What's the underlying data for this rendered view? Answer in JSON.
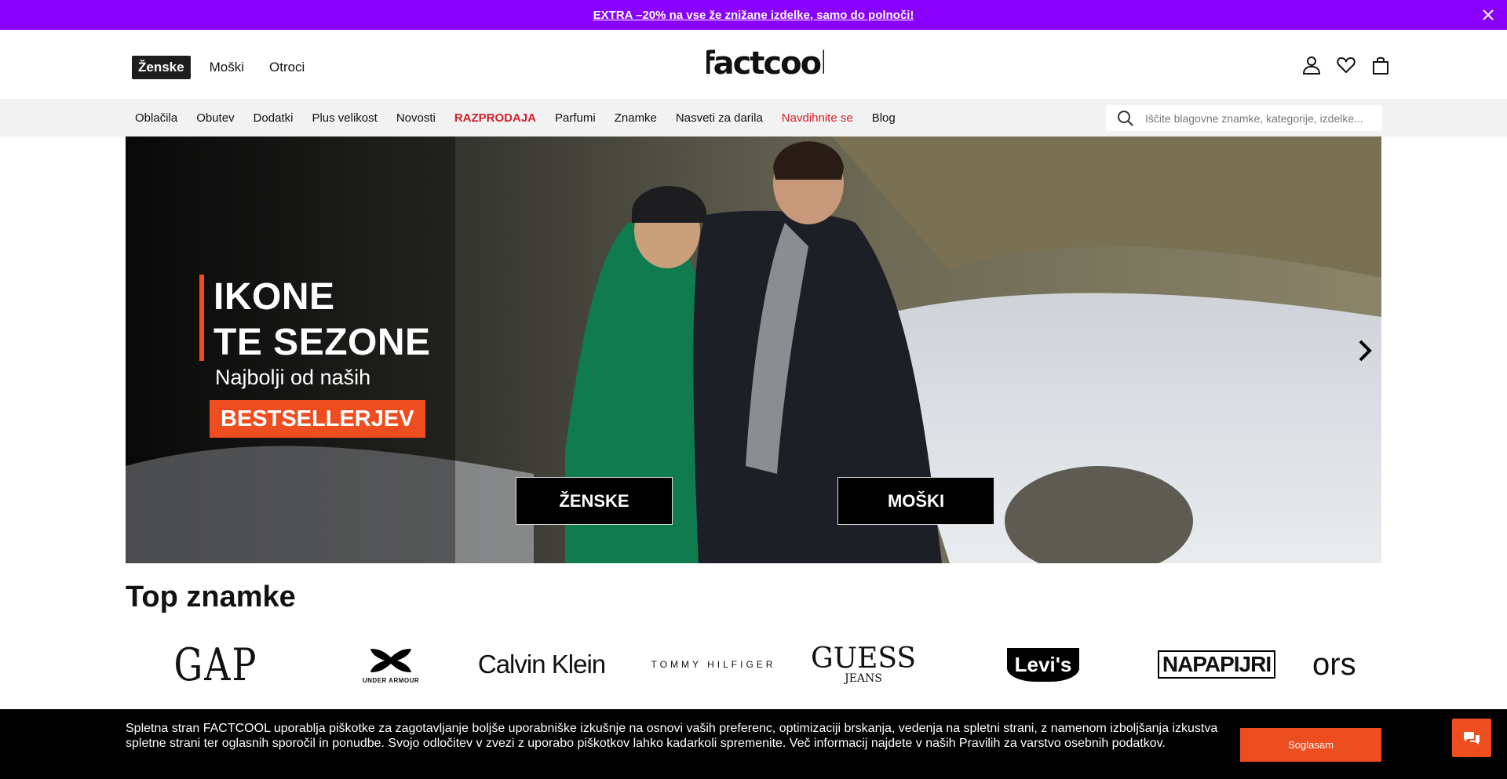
{
  "promo": {
    "text": "EXTRA –20% na vse že znižane izdelke, samo do polnoči!",
    "close_icon": "close-icon"
  },
  "header": {
    "genders": [
      {
        "label": "Ženske",
        "active": true
      },
      {
        "label": "Moški",
        "active": false
      },
      {
        "label": "Otroci",
        "active": false
      }
    ],
    "logo": "factcool",
    "icons": [
      "user-icon",
      "heart-icon",
      "bag-icon"
    ]
  },
  "nav": {
    "categories": [
      {
        "label": "Oblačila"
      },
      {
        "label": "Obutev"
      },
      {
        "label": "Dodatki"
      },
      {
        "label": "Plus velikost"
      },
      {
        "label": "Novosti"
      },
      {
        "label": "RAZPRODAJA",
        "style": "sale"
      },
      {
        "label": "Parfumi"
      },
      {
        "label": "Znamke"
      },
      {
        "label": "Nasveti za darila"
      },
      {
        "label": "Navdihnite se",
        "style": "red"
      },
      {
        "label": "Blog"
      }
    ],
    "search_placeholder": "Iščite blagovne znamke, kategorije, izdelke..."
  },
  "hero": {
    "headline_1": "IKONE",
    "headline_2": "TE SEZONE",
    "subline": "Najbolji od naših",
    "tag": "BESTSELLERJEV",
    "button_women": "ŽENSKE",
    "button_men": "MOŠKI",
    "next_icon": "chevron-right-icon"
  },
  "brands": {
    "title": "Top znamke",
    "items": [
      "GAP",
      "UNDER ARMOUR",
      "Calvin Klein",
      "TOMMY HILFIGER",
      "GUESS",
      "JEANS",
      "Levi's",
      "NAPAPIJRI",
      "ors"
    ]
  },
  "cookie": {
    "text": "Spletna stran FACTCOOL uporablja piškotke za zagotavljanje boljše uporabniške izkušnje na osnovi vaših preferenc, optimizaciji brskanja, vedenja na spletni strani, z namenom izboljšanja izkustva spletne strani ter oglasnih sporočil in ponudbe. Svojo odločitev v zvezi z uporabo piškotkov lahko kadarkoli spremenite. Več informacij najdete v naših Pravilih za varstvo osebnih podatkov.",
    "accept": "Soglasam",
    "chat_icon": "chat-icon"
  },
  "colors": {
    "promo": "#8a00ff",
    "accent": "#ee4d1f",
    "sale": "#d1202a"
  }
}
